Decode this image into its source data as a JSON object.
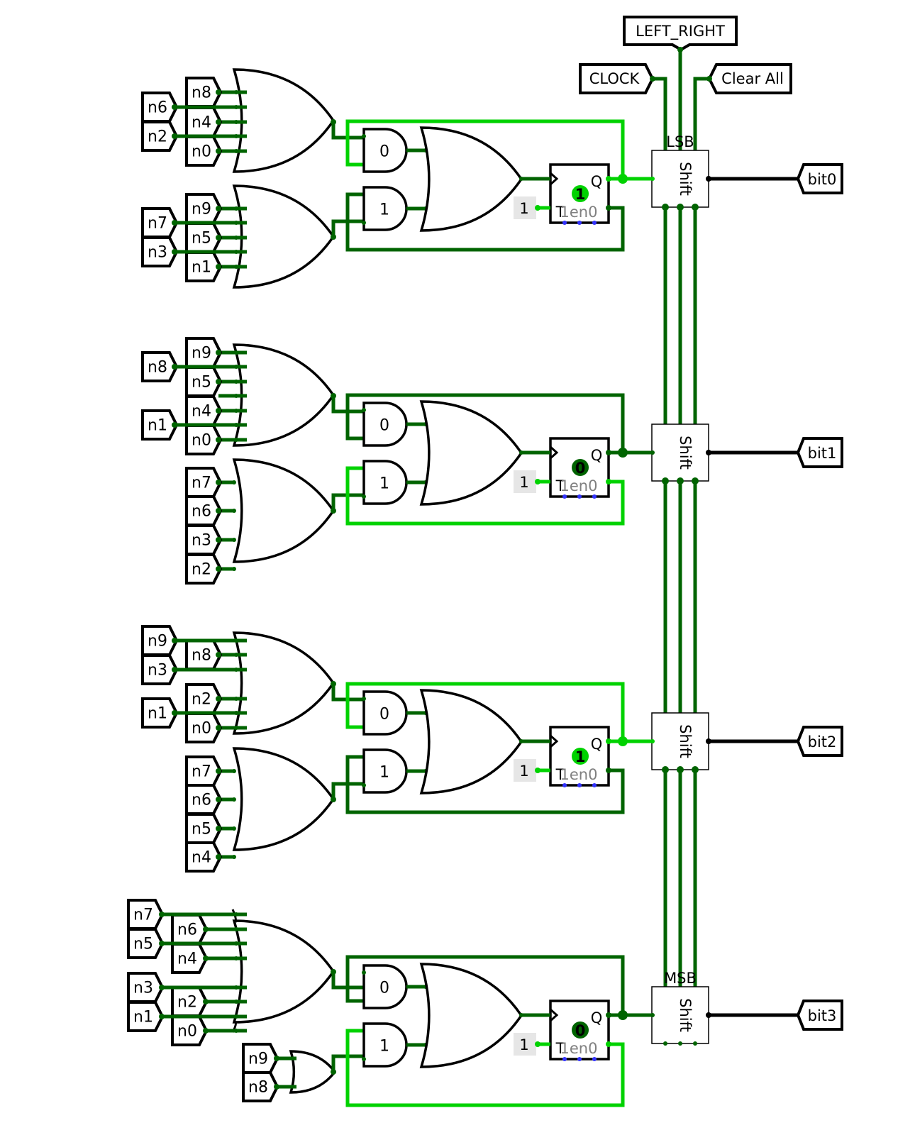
{
  "colors": {
    "wire_low": "#006400",
    "wire_high": "#00d200",
    "wire_bus": "#000000",
    "outline": "#000000",
    "sub_label": "#808080",
    "pin_dot": "#3333ff",
    "const_bg": "#e6e6e6"
  },
  "top_inputs": [
    {
      "label": "LEFT_RIGHT",
      "icon": "input-tunnel-icon"
    },
    {
      "label": "CLOCK",
      "icon": "input-tunnel-icon"
    },
    {
      "label": "Clear All",
      "icon": "input-tunnel-icon"
    }
  ],
  "shift_register": {
    "label": "Shift",
    "lsb_label": "LSB",
    "msb_label": "MSB"
  },
  "flipflop": {
    "clock_label": "Q",
    "t_label": "T",
    "sub_label": "1en0",
    "const_value": "1"
  },
  "stages": [
    {
      "output": "bit0",
      "state": "1",
      "q_high": true,
      "and_labels": [
        "0",
        "1"
      ],
      "or_top": {
        "outer": [
          "n6",
          "n2"
        ],
        "inner": [
          "n8",
          "n4",
          "n0"
        ]
      },
      "or_bottom": {
        "outer": [
          "n7",
          "n3"
        ],
        "inner": [
          "n9",
          "n5",
          "n1"
        ]
      },
      "shift_tag": "LSB"
    },
    {
      "output": "bit1",
      "state": "0",
      "q_high": false,
      "and_labels": [
        "0",
        "1"
      ],
      "or_top": {
        "outer": [
          "n8",
          "n1"
        ],
        "inner": [
          "n9",
          "n5",
          "n4",
          "n0"
        ]
      },
      "or_bottom": {
        "outer": [],
        "inner": [
          "n7",
          "n6",
          "n3",
          "n2"
        ]
      },
      "shift_tag": ""
    },
    {
      "output": "bit2",
      "state": "1",
      "q_high": true,
      "and_labels": [
        "0",
        "1"
      ],
      "or_top": {
        "outer": [
          "n9",
          "n3",
          "n1"
        ],
        "inner": [
          "n8",
          "n2",
          "n0"
        ]
      },
      "or_bottom": {
        "outer": [],
        "inner": [
          "n7",
          "n6",
          "n5",
          "n4"
        ]
      },
      "shift_tag": ""
    },
    {
      "output": "bit3",
      "state": "0",
      "q_high": false,
      "and_labels": [
        "0",
        "1"
      ],
      "or_top": {
        "outer": [
          "n7",
          "n5",
          "n3",
          "n1"
        ],
        "inner": [
          "n6",
          "n4",
          "n2",
          "n0"
        ]
      },
      "or_bottom": {
        "outer": [],
        "inner": [
          "n9",
          "n8"
        ]
      },
      "shift_tag": "MSB"
    }
  ]
}
